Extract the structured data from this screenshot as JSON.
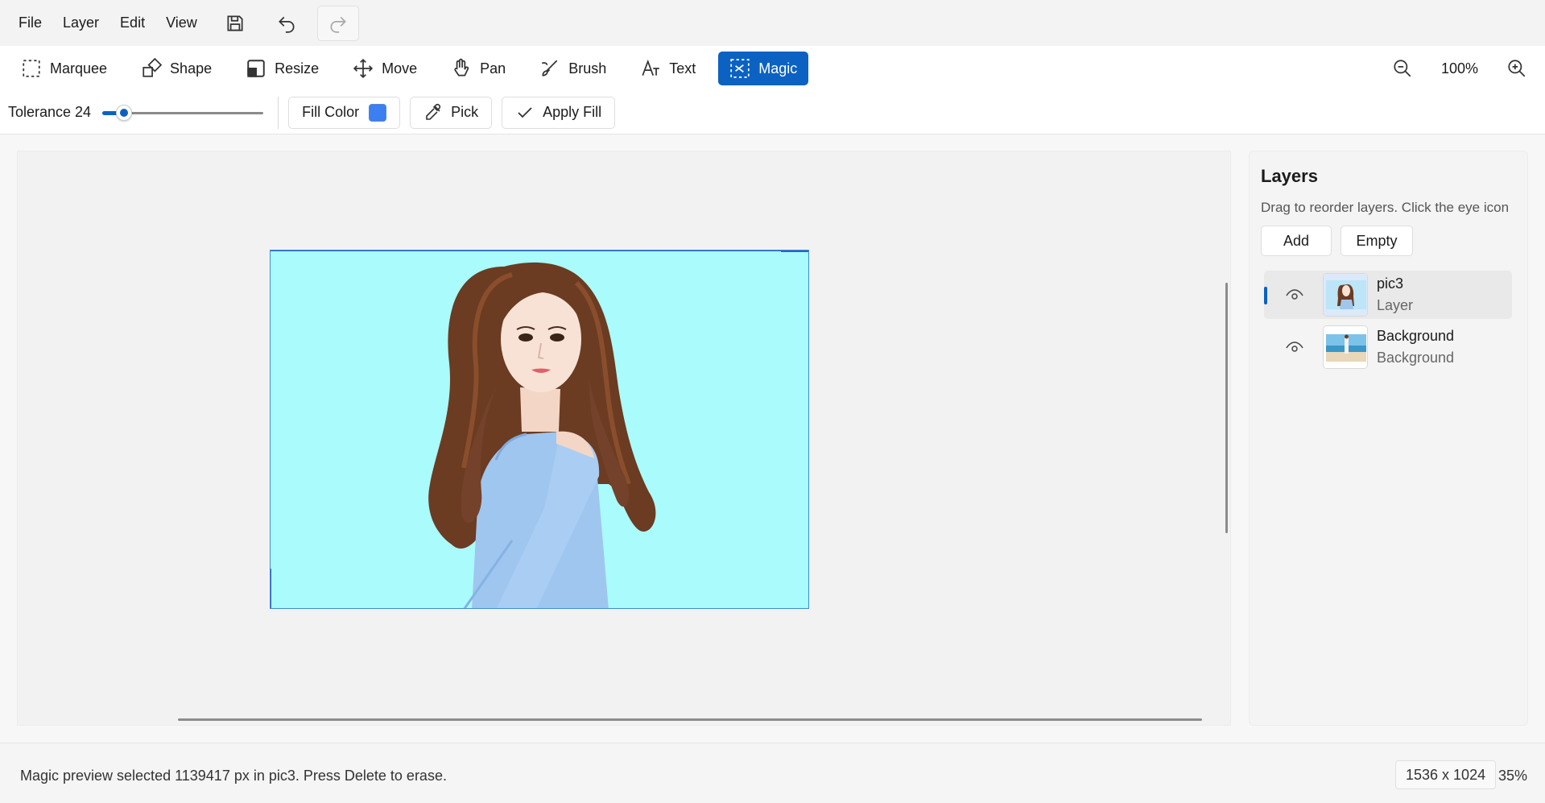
{
  "menubar": {
    "items": [
      "File",
      "Layer",
      "Edit",
      "View"
    ],
    "save_icon": "save-icon",
    "undo_icon": "undo-icon",
    "redo_icon": "redo-icon"
  },
  "toolbar": {
    "tools": [
      {
        "label": "Marquee",
        "icon": "marquee-icon"
      },
      {
        "label": "Shape",
        "icon": "shape-icon"
      },
      {
        "label": "Resize",
        "icon": "resize-icon"
      },
      {
        "label": "Move",
        "icon": "move-icon"
      },
      {
        "label": "Pan",
        "icon": "pan-hand-icon"
      },
      {
        "label": "Brush",
        "icon": "brush-icon"
      },
      {
        "label": "Text",
        "icon": "text-icon"
      },
      {
        "label": "Magic",
        "icon": "magic-scissors-icon",
        "active": true
      }
    ],
    "zoom_value": "100%"
  },
  "options": {
    "tolerance_label": "Tolerance 24",
    "tolerance_value": 24,
    "tolerance_max": 255,
    "fill_color_label": "Fill Color",
    "fill_color": "#3b7ff0",
    "pick_label": "Pick",
    "apply_fill_label": "Apply Fill"
  },
  "canvas": {
    "background_color": "#aafbfb",
    "image_subject": "woman with long wavy brown hair in light blue off-shoulder top"
  },
  "layers_panel": {
    "title": "Layers",
    "hint": "Drag to reorder layers. Click the eye icon",
    "add_label": "Add",
    "empty_label": "Empty",
    "layers": [
      {
        "name": "pic3",
        "type": "Layer",
        "selected": true,
        "visible": true
      },
      {
        "name": "Background",
        "type": "Background",
        "selected": false,
        "visible": true
      }
    ]
  },
  "status": {
    "message": "Magic preview selected 1139417 px in pic3. Press Delete to erase.",
    "dimensions": "1536 x 1024",
    "zoom": "35%"
  },
  "colors": {
    "accent": "#0b62c2"
  }
}
